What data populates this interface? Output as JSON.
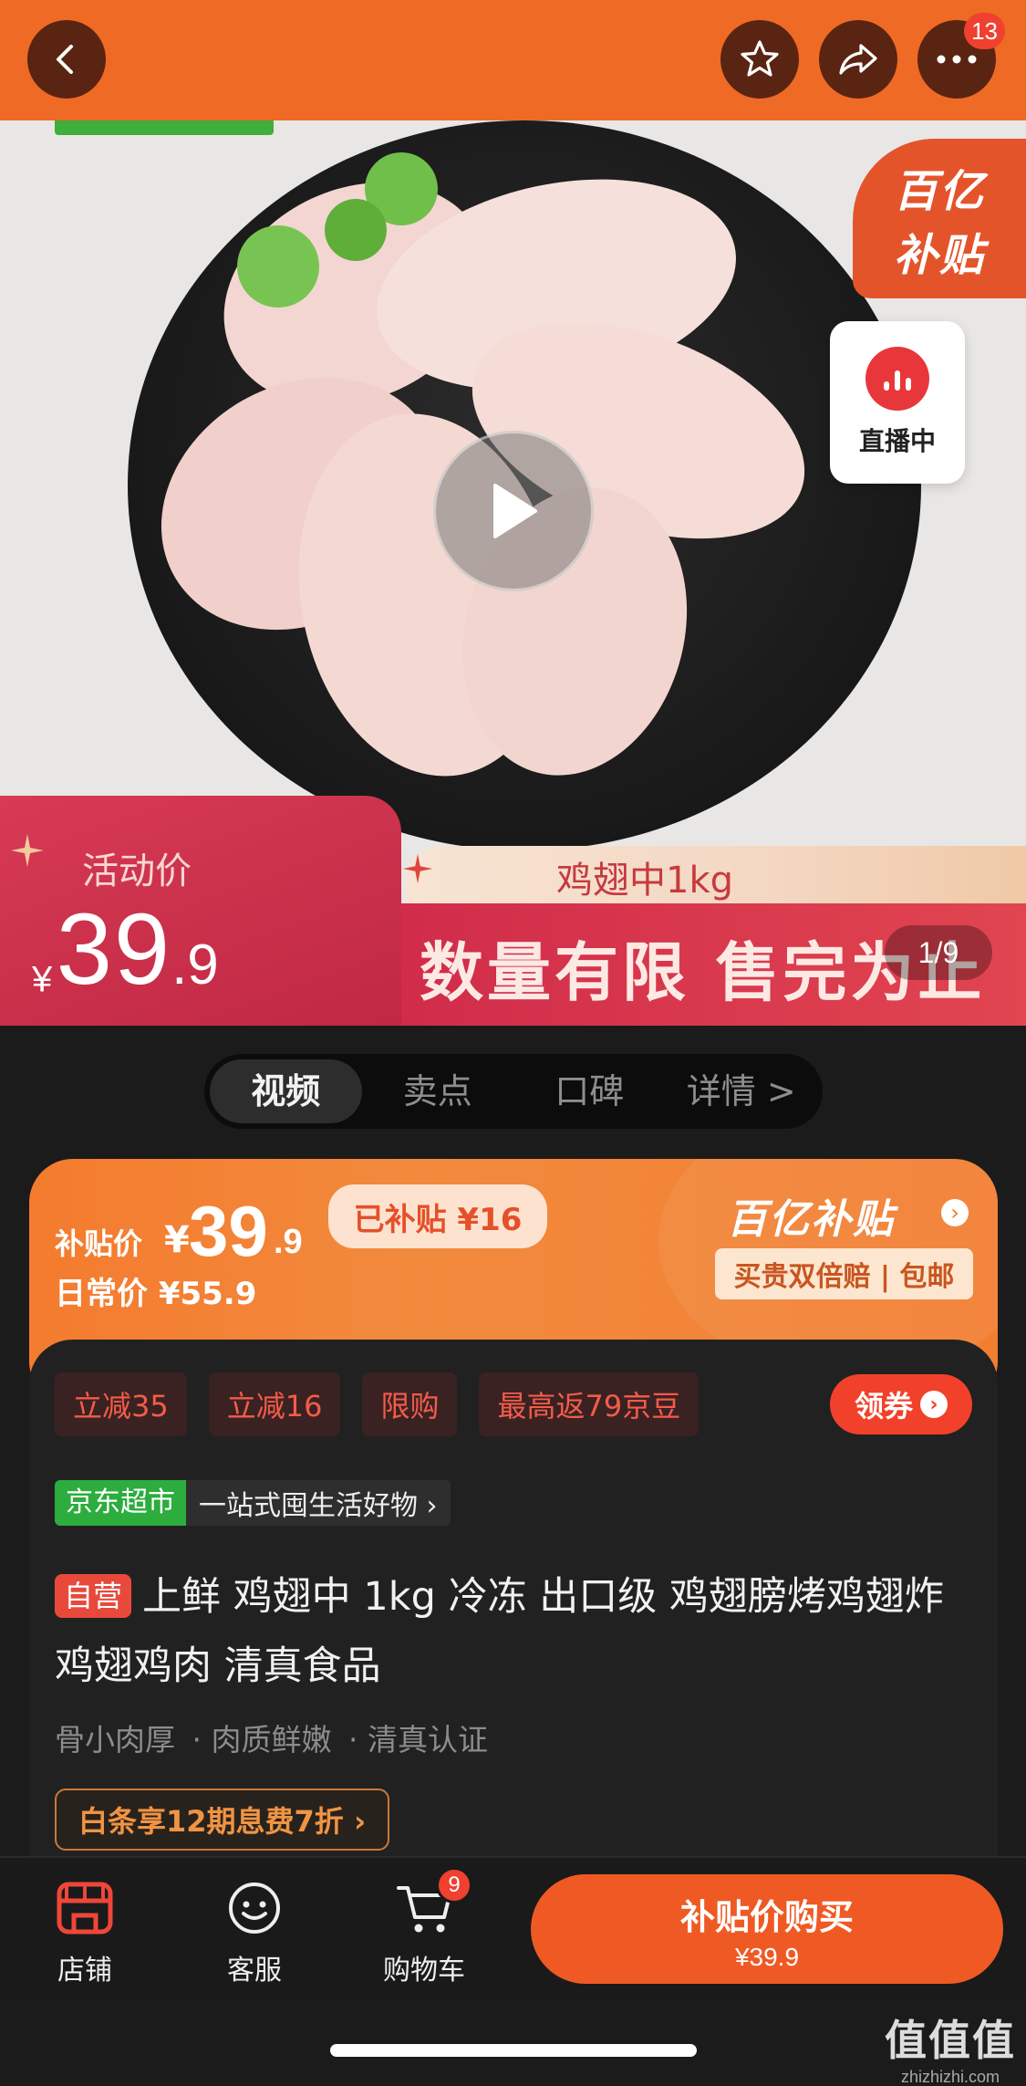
{
  "topbar": {
    "more_badge": "13"
  },
  "hero": {
    "subsidy_line1": "百亿",
    "subsidy_line2": "补贴",
    "live_label": "直播中",
    "price_label": "活动价",
    "price_currency": "¥",
    "price_int": "39",
    "price_dec": ".9",
    "ribbon_text": "鸡翅中1kg",
    "slogan": "数量有限 售完为止",
    "page_indicator": "1/9"
  },
  "tabs": [
    {
      "label": "视频",
      "active": true
    },
    {
      "label": "卖点"
    },
    {
      "label": "口碑"
    },
    {
      "label": "详情 >"
    }
  ],
  "price_card": {
    "label": "补贴价",
    "currency": "¥",
    "price_int": "39",
    "price_dec": ".9",
    "daily_price": "日常价 ¥55.9",
    "subsidized": "已补贴 ¥16",
    "brand": "百亿补贴",
    "guarantee": "买贵双倍赔 | 包邮"
  },
  "promos": [
    "立减35",
    "立减16",
    "限购",
    "最高返79京豆"
  ],
  "coupon_label": "领券",
  "store": {
    "tag": "京东超市",
    "text": "一站式囤生活好物 ›"
  },
  "product": {
    "self_tag": "自营",
    "title": "上鲜 鸡翅中 1kg 冷冻 出口级 鸡翅膀烤鸡翅炸鸡翅鸡肉 清真食品",
    "features": [
      "骨小肉厚",
      "· 肉质鲜嫩",
      "· 清真认证"
    ],
    "credit": "白条享12期息费7折 ›"
  },
  "bottom": {
    "store": "店铺",
    "service": "客服",
    "cart": "购物车",
    "cart_badge": "9",
    "buy_label": "补贴价购买",
    "buy_price": "¥39.9"
  },
  "watermark": {
    "line1": "值值值",
    "line2": "zhizhizhi.com"
  },
  "colors": {
    "accent": "#ef6a25",
    "buy": "#ef5a24",
    "promo_text": "#f45b4a"
  }
}
